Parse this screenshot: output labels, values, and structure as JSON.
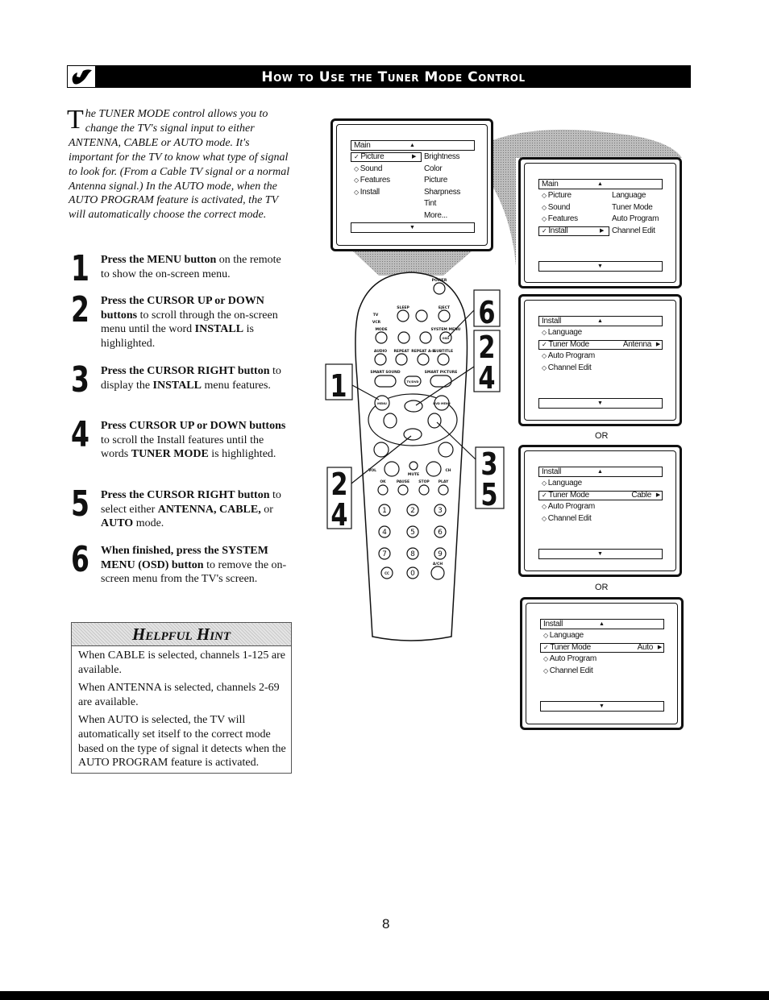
{
  "header": {
    "title": "How to Use the Tuner Mode Control",
    "icon": "wrench-icon"
  },
  "intro": {
    "dropcap": "T",
    "text": "he TUNER MODE control allows you to change the TV's signal input to either ANTENNA, CABLE or AUTO mode. It's important for the TV to know what type of signal to look for. (From a Cable TV signal or a normal Antenna signal.) In the AUTO mode, when the AUTO PROGRAM feature is activated, the TV will automatically choose the correct mode."
  },
  "steps": [
    {
      "num": "1",
      "segments": [
        {
          "b": true,
          "t": "Press the MENU button"
        },
        {
          "b": false,
          "t": " on the remote to show the on-screen menu."
        }
      ]
    },
    {
      "num": "2",
      "segments": [
        {
          "b": true,
          "t": "Press the CURSOR UP or DOWN buttons"
        },
        {
          "b": false,
          "t": " to scroll through the on-screen menu until the word "
        },
        {
          "b": true,
          "t": "INSTALL"
        },
        {
          "b": false,
          "t": " is highlighted."
        }
      ]
    },
    {
      "num": "3",
      "segments": [
        {
          "b": true,
          "t": "Press the CURSOR RIGHT button"
        },
        {
          "b": false,
          "t": " to display the "
        },
        {
          "b": true,
          "t": "INSTALL"
        },
        {
          "b": false,
          "t": " menu features."
        }
      ]
    },
    {
      "num": "4",
      "segments": [
        {
          "b": true,
          "t": "Press CURSOR UP or DOWN buttons"
        },
        {
          "b": false,
          "t": " to scroll the Install features until the words "
        },
        {
          "b": true,
          "t": "TUNER MODE"
        },
        {
          "b": false,
          "t": " is highlighted."
        }
      ]
    },
    {
      "num": "5",
      "segments": [
        {
          "b": true,
          "t": "Press the CURSOR RIGHT button"
        },
        {
          "b": false,
          "t": " to select either "
        },
        {
          "b": true,
          "t": "ANTENNA, CABLE,"
        },
        {
          "b": false,
          "t": " or "
        },
        {
          "b": true,
          "t": "AUTO"
        },
        {
          "b": false,
          "t": " mode."
        }
      ]
    },
    {
      "num": "6",
      "segments": [
        {
          "b": true,
          "t": "When finished, press the SYSTEM MENU (OSD) button"
        },
        {
          "b": false,
          "t": " to remove the on-screen menu from the TV's screen."
        }
      ]
    }
  ],
  "hint": {
    "title": "Helpful Hint",
    "paragraphs": [
      "When CABLE is selected, channels 1-125 are available.",
      "When ANTENNA is selected, channels 2-69 are available.",
      "When AUTO is selected, the TV will automatically set itself to the correct mode based on the type of signal it detects when the AUTO PROGRAM feature is activated."
    ]
  },
  "screens": [
    {
      "title": "Main",
      "highlight": "left",
      "rows": [
        {
          "left": "Picture",
          "mark": "check",
          "right": "Brightness",
          "selected": true
        },
        {
          "left": "Sound",
          "mark": "diamond",
          "right": "Color"
        },
        {
          "left": "Features",
          "mark": "diamond",
          "right": "Picture"
        },
        {
          "left": "Install",
          "mark": "diamond",
          "right": "Sharpness"
        },
        {
          "left": "",
          "right": "Tint"
        },
        {
          "left": "",
          "right": "More..."
        }
      ]
    },
    {
      "title": "Main",
      "highlight": "left",
      "rows": [
        {
          "left": "Picture",
          "mark": "diamond",
          "right": "Language"
        },
        {
          "left": "Sound",
          "mark": "diamond",
          "right": "Tuner Mode"
        },
        {
          "left": "Features",
          "mark": "diamond",
          "right": "Auto Program"
        },
        {
          "left": "Install",
          "mark": "check",
          "right": "Channel Edit",
          "selected": true
        }
      ]
    },
    {
      "title": "Install",
      "highlight": "full",
      "rows": [
        {
          "left": "Language",
          "mark": "diamond"
        },
        {
          "left": "Tuner Mode",
          "mark": "check",
          "value": "Antenna",
          "selected": true
        },
        {
          "left": "Auto Program",
          "mark": "diamond"
        },
        {
          "left": "Channel Edit",
          "mark": "diamond"
        }
      ]
    },
    {
      "title": "Install",
      "highlight": "full",
      "rows": [
        {
          "left": "Language",
          "mark": "diamond"
        },
        {
          "left": "Tuner Mode",
          "mark": "check",
          "value": "Cable",
          "selected": true
        },
        {
          "left": "Auto Program",
          "mark": "diamond"
        },
        {
          "left": "Channel Edit",
          "mark": "diamond"
        }
      ]
    },
    {
      "title": "Install",
      "highlight": "full",
      "rows": [
        {
          "left": "Language",
          "mark": "diamond"
        },
        {
          "left": "Tuner Mode",
          "mark": "check",
          "value": "Auto",
          "selected": true
        },
        {
          "left": "Auto Program",
          "mark": "diamond"
        },
        {
          "left": "Channel Edit",
          "mark": "diamond"
        }
      ]
    }
  ],
  "or_label": "OR",
  "remote": {
    "power": "POWER",
    "sleep": "SLEEP",
    "eject": "EJECT",
    "tv": "TV",
    "vcr": "VCR",
    "mode": "MODE",
    "system_menu": "SYSTEM MENU",
    "osd": "OSD",
    "audio": "AUDIO",
    "repeat": "REPEAT",
    "repeat_ab": "REPEAT A-B",
    "subtitle": "SUBTITLE",
    "smart_sound": "SMART SOUND",
    "smart_picture": "SMART PICTURE",
    "tv_dvd": "TV/DVD",
    "menu": "MENU",
    "dvd_menu": "DVD MENU",
    "vol": "VOL",
    "ch": "CH",
    "mute": "MUTE",
    "ok": "OK",
    "pause": "PAUSE",
    "stop": "STOP",
    "play": "PLAY",
    "digits": [
      "1",
      "2",
      "3",
      "4",
      "5",
      "6",
      "7",
      "8",
      "9",
      "0"
    ],
    "cc": "CC",
    "a_ch": "A/CH",
    "callouts": {
      "menu": "1",
      "osd": "6",
      "up_a": "2",
      "up_b": "4",
      "down_a": "2",
      "down_b": "4",
      "right_a": "3",
      "right_b": "5"
    }
  },
  "page_number": "8"
}
